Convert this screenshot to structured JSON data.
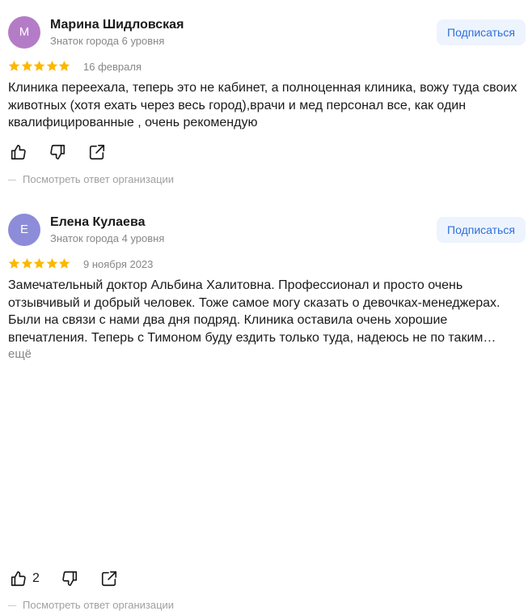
{
  "reviews": [
    {
      "avatar_letter": "М",
      "avatar_color": "#b47cc7",
      "name": "Марина Шидловская",
      "level": "Знаток города 6 уровня",
      "subscribe_label": "Подписаться",
      "rating": 5,
      "date": "16 февраля",
      "text": "Клиника переехала, теперь это не кабинет, а полноценная клиника, вожу туда своих животных (хотя ехать через весь город),врачи и мед персонал все, как один квалифицированные , очень рекомендую",
      "more_label": "",
      "likes": "",
      "org_reply_label": "Посмотреть ответ организации"
    },
    {
      "avatar_letter": "Е",
      "avatar_color": "#8c8cd9",
      "name": "Елена Кулаева",
      "level": "Знаток города 4 уровня",
      "subscribe_label": "Подписаться",
      "rating": 5,
      "date": "9 ноября 2023",
      "text": "Замечательный доктор Альбина Халитовна. Профессионал и просто очень отзывчивый и добрый человек. Тоже самое могу сказать о девочках-менеджерах. Были на связи с нами два дня подряд. Клиника оставила очень хорошие впечатления. Теперь с Тимоном буду ездить только туда, надеюсь не по таким…",
      "more_label": "ещё",
      "likes": "2",
      "org_reply_label": "Посмотреть ответ организации"
    }
  ],
  "colors": {
    "star": "#fcb800",
    "accent": "#2e6fd8",
    "button_bg": "#eef4fe",
    "muted": "#878787"
  },
  "icons": [
    "thumbs-up-icon",
    "thumbs-down-icon",
    "share-icon",
    "star-icon"
  ]
}
